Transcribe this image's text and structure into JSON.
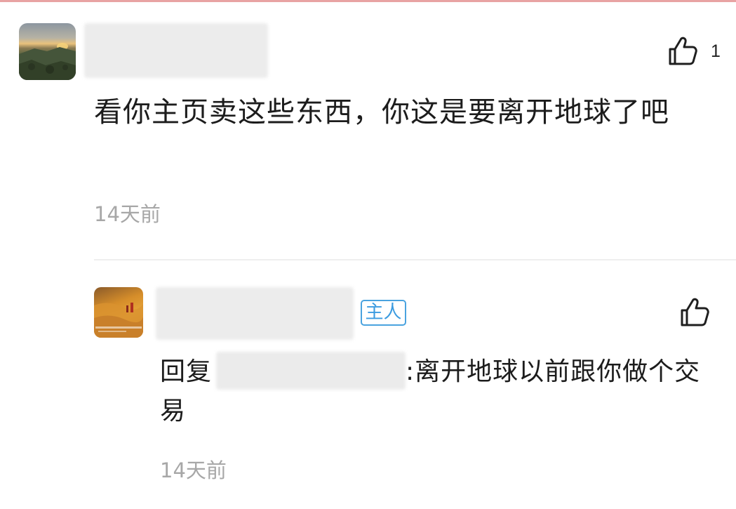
{
  "comment": {
    "like_count": "1",
    "text": "看你主页卖这些东西，你这是要离开地球了吧",
    "time": "14天前"
  },
  "reply": {
    "badge": "主人",
    "prefix": "回复",
    "text": ":离开地球以前跟你做个交易",
    "time": "14天前"
  },
  "icons": {
    "like": "thumbs-up-icon"
  }
}
